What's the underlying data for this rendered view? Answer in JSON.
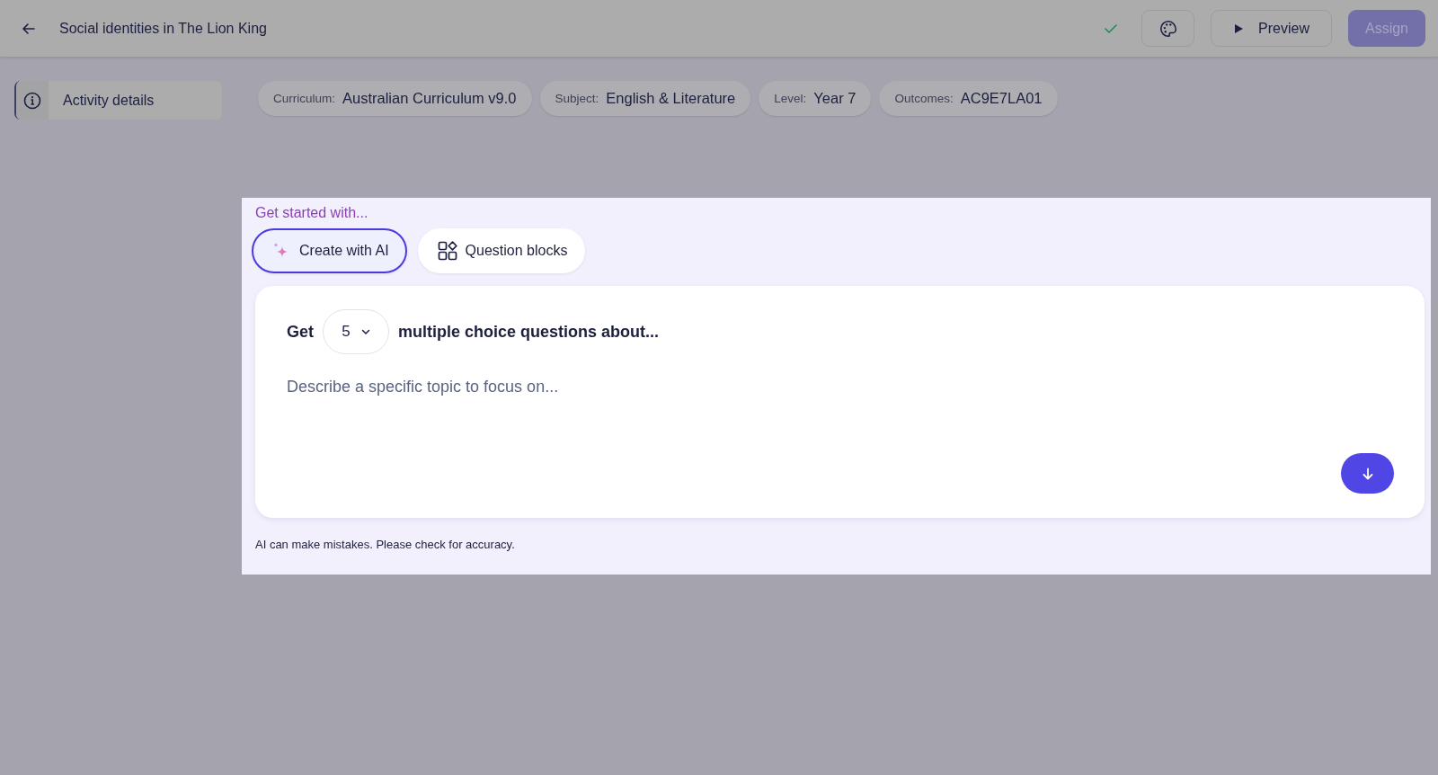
{
  "header": {
    "title": "Social identities in The Lion King",
    "saved": true,
    "preview_label": "Preview",
    "assign_label": "Assign",
    "assign_disabled": true
  },
  "sidebar": {
    "items": [
      {
        "label": "Activity details",
        "selected": true
      }
    ]
  },
  "tags": [
    {
      "label": "Curriculum:",
      "value": "Australian Curriculum v9.0"
    },
    {
      "label": "Subject:",
      "value": "English & Literature"
    },
    {
      "label": "Level:",
      "value": "Year 7"
    },
    {
      "label": "Outcomes:",
      "value": "AC9E7LA01"
    }
  ],
  "panel": {
    "heading": "Get started with...",
    "tabs": [
      {
        "label": "Create with AI",
        "kind": "ai",
        "selected": true
      },
      {
        "label": "Question blocks",
        "kind": "blocks",
        "selected": false
      }
    ],
    "prompt": {
      "prefix": "Get",
      "count": "5",
      "suffix": "multiple choice questions about...",
      "placeholder": "Describe a specific topic to focus on..."
    },
    "disclaimer": "AI can make mistakes. Please check for accuracy."
  }
}
